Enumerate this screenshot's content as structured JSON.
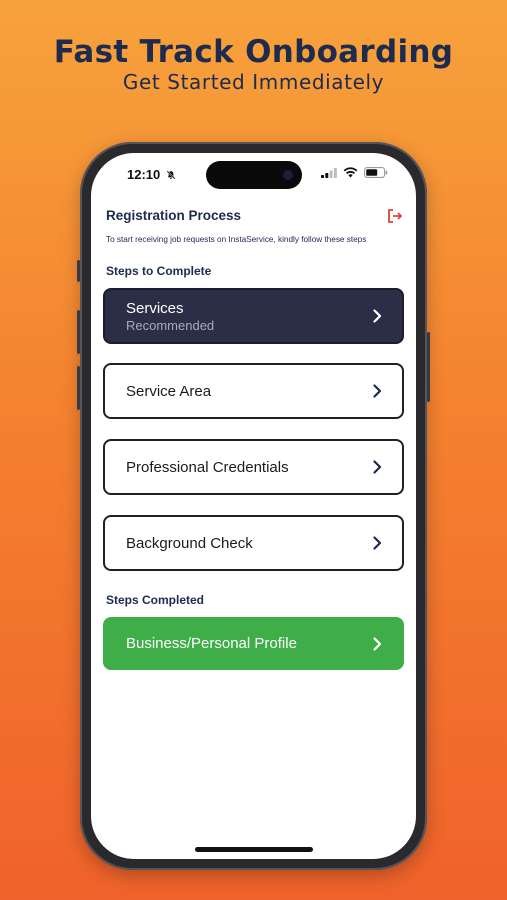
{
  "promo": {
    "headline": "Fast Track Onboarding",
    "subheadline": "Get Started Immediately"
  },
  "status_bar": {
    "time": "12:10",
    "icons": [
      "bell-slash-icon",
      "cellular-signal-icon",
      "wifi-icon",
      "battery-icon"
    ]
  },
  "header": {
    "title": "Registration Process",
    "logout_icon": "logout-icon",
    "instructions": "To start receiving job requests on InstaService, kindly follow these steps"
  },
  "steps_to_complete": {
    "label": "Steps to Complete",
    "items": [
      {
        "label": "Services",
        "sublabel": "Recommended"
      },
      {
        "label": "Service Area"
      },
      {
        "label": "Professional Credentials"
      },
      {
        "label": "Background Check"
      }
    ]
  },
  "steps_completed": {
    "label": "Steps Completed",
    "items": [
      {
        "label": "Business/Personal Profile"
      }
    ]
  },
  "colors": {
    "navy_text": "#1d2b4f",
    "active_step_bg": "#2c2e48",
    "completed_step_bg": "#3fae49",
    "logout_red": "#e0403a",
    "bg_gradient_top": "#f7a23c",
    "bg_gradient_bottom": "#f0622b"
  }
}
